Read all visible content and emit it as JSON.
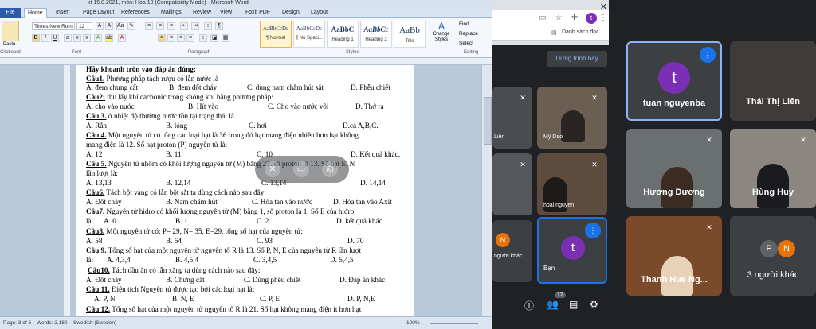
{
  "word": {
    "title": "kt 15.8.2021, môn: Hóa 10 (Compatibility Mode) - Microsoft Word",
    "tabs": [
      "File",
      "Home",
      "Insert",
      "Page Layout",
      "References",
      "Mailings",
      "Review",
      "View",
      "Foxit PDF",
      "Design",
      "Layout"
    ],
    "font_name": "Times New Rom",
    "font_size": "12",
    "styles": [
      {
        "preview": "AaBbCcDc",
        "name": "¶ Normal"
      },
      {
        "preview": "AaBbCcDc",
        "name": "¶ No Spaci..."
      },
      {
        "preview": "AaBbC",
        "name": "Heading 1"
      },
      {
        "preview": "AaBbCc",
        "name": "Heading 2"
      },
      {
        "preview": "AaBb",
        "name": "Title"
      }
    ],
    "change_styles": "Change Styles",
    "editing": {
      "find": "Find",
      "replace": "Replace",
      "select": "Select"
    },
    "groups": {
      "clipboard": "Clipboard",
      "font": "Font",
      "paragraph": "Paragraph",
      "styles": "Styles",
      "editing": "Editing"
    },
    "paste": "Paste",
    "status": {
      "page": "Page: 3 of 6",
      "words": "Words: 2,180",
      "language": "Swedish (Sweden)",
      "zoom": "100%"
    }
  },
  "document": {
    "heading": "Hãy khoanh tròn vào đáp án đúng:",
    "questions": [
      {
        "num": "Câu1.",
        "text": "Phương pháp tách rượu có lẫn nước là",
        "options": [
          "A. đem chưng cất",
          "B. đem đốt cháy",
          "C. dùng nam châm hút sắt",
          "D. Phễu chiết"
        ]
      },
      {
        "num": "Câu2:",
        "text": "thu lấy khí cacbonic trong không khí bằng phương pháp:",
        "options": [
          "A. cho vào nước",
          "B. Hít vào",
          "C. Cho vào nước vôi",
          "D. Thở ra"
        ]
      },
      {
        "num": "Câu 3.",
        "text": "ở nhiệt độ thường nước tồn tại trạng thái là",
        "options": [
          "A. Rắn",
          "B. lỏng",
          "C. hơi",
          "D.cả A,B,C."
        ]
      },
      {
        "num": "Câu 4.",
        "text": "Một nguyên tử có tổng các loại hạt là 36 trong đó hạt mang điện nhiều hơn hạt không",
        "line2": "mang điện là 12. Số hạt proton (P) nguyên tử là:",
        "options": [
          "A. 12",
          "B. 11",
          "C. 10",
          "D. Kết quả khác."
        ]
      },
      {
        "num": "Câu 5.",
        "text": "Nguyên tử nhôm có khối lượng nguyên tử (M) bằng 27, số proton là 13. Số hạt E, N",
        "line2": "lần lượt là:",
        "options": [
          "A. 13,13",
          "B. 12,14",
          "C. 13,14",
          "D. 14,14"
        ]
      },
      {
        "num": "Câu6.",
        "text": "Tách bột vàng có lẫn bột sắt ta dùng cách nào sau đây:",
        "options": [
          "A. Đốt cháy",
          "B. Nam châm hút",
          "C. Hòa tan vào nước",
          "D. Hòa tan vào Axit"
        ]
      },
      {
        "num": "Câu7.",
        "text": "Nguyên tử hidro có khối lượng nguyên tử (M) bằng 1, số proton là 1. Số E của hiđro",
        "line2label": "là",
        "options": [
          "A. 0",
          "B. 1",
          "C. 2",
          "D. kết quả khác."
        ]
      },
      {
        "num": "Câu8.",
        "text": "Một nguyên tử có: P= 29, N= 35, E=29, tổng số hạt của nguyên tử:",
        "options": [
          "A. 58",
          "B. 64",
          "C. 93",
          "D. 70"
        ]
      },
      {
        "num": "Câu 9.",
        "text": "Tổng số hạt của một nguyên tử nguyên tố R là 13. Số P, N, E của nguyên tử R lần lượt",
        "line2label": "là:",
        "options": [
          "A. 4,3,4",
          "B. 4,5,4",
          "C. 3,4,5",
          "D. 5,4,5"
        ]
      },
      {
        "num": "Câu10.",
        "text": "Tách dầu ăn có lẫn xăng ta dùng cách nào sau đây:",
        "options": [
          "A. Đốt cháy",
          "B. Chưng cất",
          "C. Dùng phễu chiết",
          "D. Đáp án khác"
        ]
      },
      {
        "num": "Câu 11.",
        "text": "Điện tích Nguyên tử được tạo bởi các loại hạt là:",
        "options": [
          "A. P, N",
          "B. N, E",
          "C. P, E",
          "D. P, N,E"
        ]
      },
      {
        "num": "Câu 12.",
        "text": "Tổng số hạt của một nguyên tử nguyên tố R là 21. Số hạt không mang điện ít hơn hạt"
      }
    ]
  },
  "chrome": {
    "profile_letter": "t",
    "bookmark": "Danh sách đọc"
  },
  "meet": {
    "presenting": "Dừng trình bày",
    "participants": [
      {
        "name": "tuan nguyenba",
        "avatar": "t"
      },
      {
        "name": "Thái Thị Liên"
      },
      {
        "name": "Hương Dương"
      },
      {
        "name": "Hùng Huy"
      },
      {
        "name": "Thanh Hue Ng..."
      },
      {
        "name": "3 người khác",
        "avatars": [
          "P",
          "N"
        ]
      },
      {
        "name": "Bạn",
        "avatar": "t"
      },
      {
        "name": "Liên"
      },
      {
        "name": "Mỹ Dao"
      },
      {
        "name": "hoài nguyen"
      },
      {
        "name": "người khác",
        "avatar": "N"
      }
    ],
    "chat_count": "12"
  }
}
